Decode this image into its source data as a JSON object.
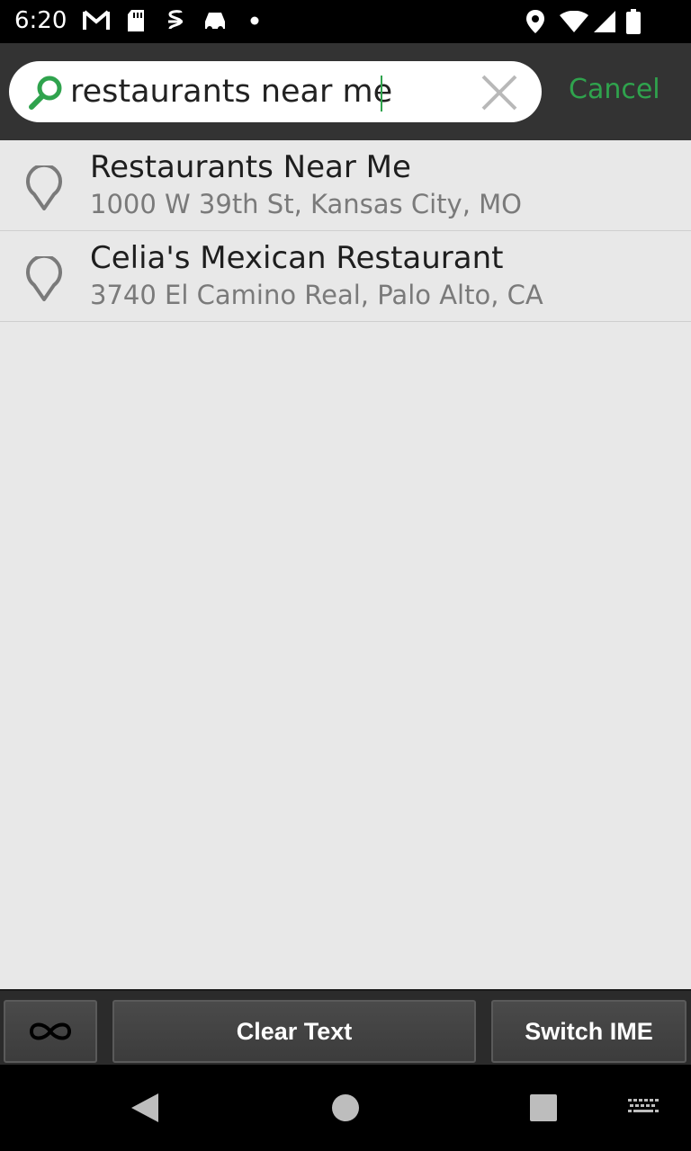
{
  "status_bar": {
    "time": "6:20",
    "icons": [
      "gmail-icon",
      "sd-card-icon",
      "app-icon",
      "car-icon",
      "dot-icon",
      "location-icon",
      "wifi-icon",
      "signal-icon",
      "battery-icon"
    ]
  },
  "search": {
    "value": "restaurants near me",
    "cancel_label": "Cancel",
    "accent_color": "#2fa34d"
  },
  "results": [
    {
      "title": "Restaurants Near Me",
      "address": "1000 W 39th St, Kansas City, MO"
    },
    {
      "title": "Celia's Mexican Restaurant",
      "address": "3740 El Camino Real, Palo Alto, CA"
    }
  ],
  "ime_bar": {
    "clear_label": "Clear Text",
    "switch_label": "Switch IME"
  },
  "nav": [
    "back-icon",
    "home-icon",
    "recents-icon",
    "keyboard-icon"
  ]
}
